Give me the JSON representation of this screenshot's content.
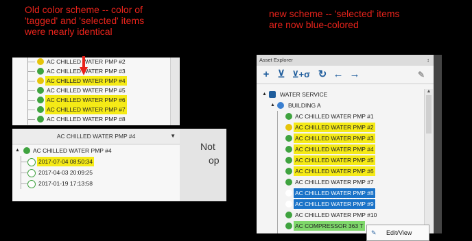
{
  "captions": {
    "old": [
      "Old color scheme -- color of",
      "'tagged' and 'selected' items",
      "were nearly identical"
    ],
    "new": [
      "new scheme -- 'selected' items",
      "are now blue-colored"
    ]
  },
  "left": {
    "tree_rows": [
      {
        "label": "AC CHILLED WATER PMP #2",
        "hl": "none",
        "icon": "yellow"
      },
      {
        "label": "AC CHILLED WATER PMP #3",
        "hl": "none",
        "icon": "green"
      },
      {
        "label": "AC CHILLED WATER PMP #4",
        "hl": "yellow",
        "icon": "yellow"
      },
      {
        "label": "AC CHILLED WATER PMP #5",
        "hl": "none",
        "icon": "green"
      },
      {
        "label": "AC CHILLED WATER PMP #6",
        "hl": "yellow",
        "icon": "green"
      },
      {
        "label": "AC CHILLED WATER PMP #7",
        "hl": "yellow",
        "icon": "green"
      },
      {
        "label": "AC CHILLED WATER PMP #8",
        "hl": "none",
        "icon": "green"
      }
    ],
    "dropdown_value": "AC CHILLED WATER PMP #4",
    "parent_label": "AC CHILLED WATER PMP #4",
    "dates": [
      {
        "label": "2017-07-04 08:50:34",
        "hl": "yellow"
      },
      {
        "label": "2017-04-03 20:09:25",
        "hl": "none"
      },
      {
        "label": "2017-01-19 17:13:58",
        "hl": "none"
      }
    ],
    "side_text_1": "Not",
    "side_text_2": "op"
  },
  "right": {
    "title": "Asset Explorer",
    "pin_glyph": "↕",
    "toolbar": [
      "+",
      "⊻",
      "⊻+σ",
      "↻",
      "←",
      "→"
    ],
    "root_label": "WATER SERVICE",
    "building_label": "BUILDING A",
    "tree_rows": [
      {
        "label": "AC CHILLED WATER PMP #1",
        "hl": "none",
        "icon": "green"
      },
      {
        "label": "AC CHILLED WATER PMP #2",
        "hl": "yellow",
        "icon": "yellow"
      },
      {
        "label": "AC CHILLED WATER PMP #3",
        "hl": "yellow",
        "icon": "green"
      },
      {
        "label": "AC CHILLED WATER PMP #4",
        "hl": "yellow",
        "icon": "green"
      },
      {
        "label": "AC CHILLED WATER PMP #5",
        "hl": "yellow",
        "icon": "green"
      },
      {
        "label": "AC CHILLED WATER PMP #6",
        "hl": "yellow",
        "icon": "green"
      },
      {
        "label": "AC CHILLED WATER PMP #7",
        "hl": "none",
        "icon": "green"
      },
      {
        "label": "AC CHILLED WATER PMP #8",
        "hl": "blue",
        "icon": "blue"
      },
      {
        "label": "AC CHILLED WATER PMP #9",
        "hl": "blue",
        "icon": "blue"
      },
      {
        "label": "AC CHILLED WATER PMP #10",
        "hl": "none",
        "icon": "green"
      },
      {
        "label": "AC COMPRESSOR 363 T",
        "hl": "green",
        "icon": "green"
      },
      {
        "label": "AC COMPRESSOR 363 T",
        "hl": "none",
        "icon": "green"
      }
    ],
    "context_menu": "Edit/View"
  },
  "colors": {
    "caption": "#e8231b",
    "tagged_old": "#f5ea16",
    "selected_new": "#1a73c8",
    "green_highlight": "#7fd86b"
  }
}
